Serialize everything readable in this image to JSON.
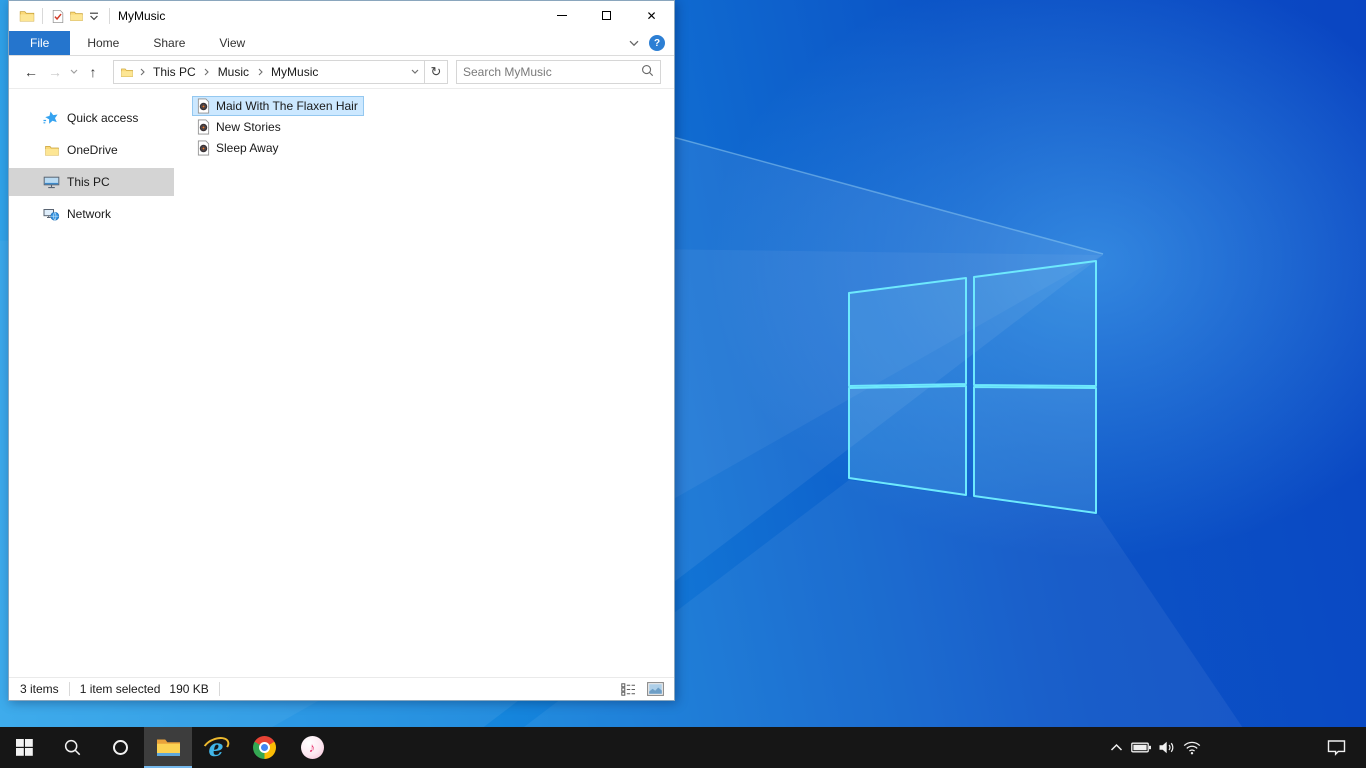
{
  "titlebar": {
    "title": "MyMusic"
  },
  "ribbon": {
    "tabs": [
      "File",
      "Home",
      "Share",
      "View"
    ],
    "help_label": "?"
  },
  "icons": {
    "back": "←",
    "forward": "→",
    "up": "↑",
    "refresh": "↻",
    "close": "✕",
    "music_note": "♪",
    "ie_letter": "e"
  },
  "address": {
    "breadcrumb": [
      "This PC",
      "Music",
      "MyMusic"
    ],
    "search_placeholder": "Search MyMusic"
  },
  "sidebar": {
    "items": [
      {
        "label": "Quick access",
        "icon": "quick-access-star"
      },
      {
        "label": "OneDrive",
        "icon": "folder"
      },
      {
        "label": "This PC",
        "icon": "monitor",
        "selected": true
      },
      {
        "label": "Network",
        "icon": "network"
      }
    ]
  },
  "files": [
    {
      "name": "Maid With The Flaxen Hair",
      "icon": "music-file",
      "selected": true
    },
    {
      "name": "New Stories",
      "icon": "music-file",
      "selected": false
    },
    {
      "name": "Sleep Away",
      "icon": "music-file",
      "selected": false
    }
  ],
  "status": {
    "count": "3 items",
    "selection": "1 item selected",
    "size": "190 KB"
  },
  "taskbar": {
    "buttons": [
      "start",
      "search",
      "cortana",
      "file-explorer",
      "internet-explorer",
      "chrome",
      "itunes"
    ],
    "active_button": "file-explorer"
  },
  "tray": {
    "icons": [
      "hidden-icons-chevron",
      "battery",
      "volume",
      "wifi",
      "action-center"
    ]
  },
  "colors": {
    "accent": "#2575cd",
    "selection_fill": "#cce8ff",
    "selection_border": "#94c8f0",
    "nav_selected": "#d4d4d4",
    "taskbar": "#161616",
    "taskbar_underline": "#76b9ed"
  }
}
